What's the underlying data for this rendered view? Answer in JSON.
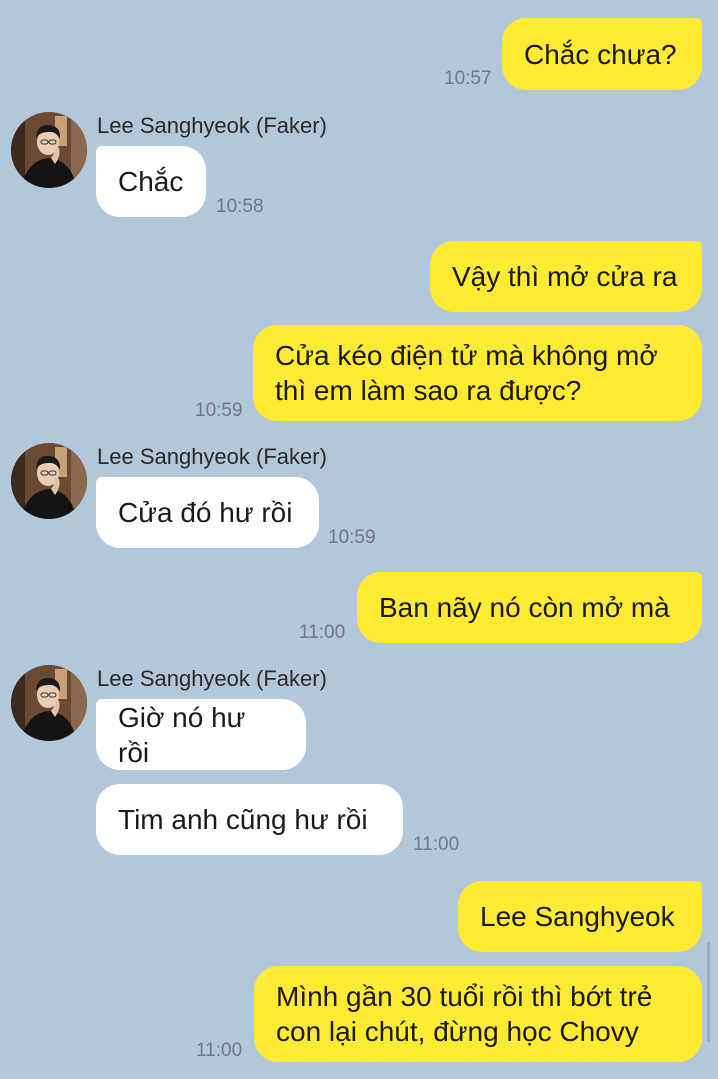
{
  "sender": {
    "name": "Lee Sanghyeok (Faker)",
    "avatar_icon": "profile-photo"
  },
  "colors": {
    "background": "#b2c7d9",
    "outgoing": "#fee933",
    "incoming": "#ffffff",
    "time": "#6e7a84"
  },
  "messages": [
    {
      "from": "me",
      "text": "Chắc chưa?",
      "time": "10:57"
    },
    {
      "from": "them",
      "text": "Chắc",
      "time": "10:58"
    },
    {
      "from": "me",
      "text": "Vậy thì mở cửa ra",
      "time": ""
    },
    {
      "from": "me",
      "text": "Cửa kéo điện tử mà không mở\nthì em làm sao ra được?",
      "time": "10:59"
    },
    {
      "from": "them",
      "text": "Cửa đó hư rồi",
      "time": "10:59"
    },
    {
      "from": "me",
      "text": "Ban nãy nó còn mở mà",
      "time": "11:00"
    },
    {
      "from": "them",
      "text": "Giờ nó hư rồi",
      "time": ""
    },
    {
      "from": "them",
      "text": "Tim anh cũng hư rồi",
      "time": "11:00"
    },
    {
      "from": "me",
      "text": "Lee Sanghyeok",
      "time": ""
    },
    {
      "from": "me",
      "text": "Mình gần 30 tuổi rồi thì bớt trẻ\ncon lại chút, đừng học Chovy",
      "time": "11:00"
    }
  ]
}
